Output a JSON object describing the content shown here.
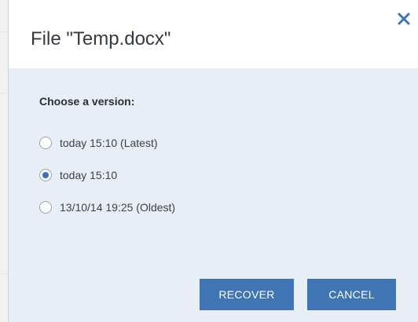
{
  "dialog": {
    "title": "File \"Temp.docx\"",
    "close_icon": "close-icon",
    "section_label": "Choose a version:",
    "versions": [
      {
        "label": "today 15:10 (Latest)",
        "selected": false
      },
      {
        "label": "today 15:10",
        "selected": true
      },
      {
        "label": "13/10/14 19:25 (Oldest)",
        "selected": false
      }
    ],
    "recover_label": "RECOVER",
    "cancel_label": "CANCEL"
  },
  "colors": {
    "accent": "#3f74b5",
    "header_bg": "#ffffff",
    "body_bg": "#e8eef6"
  }
}
